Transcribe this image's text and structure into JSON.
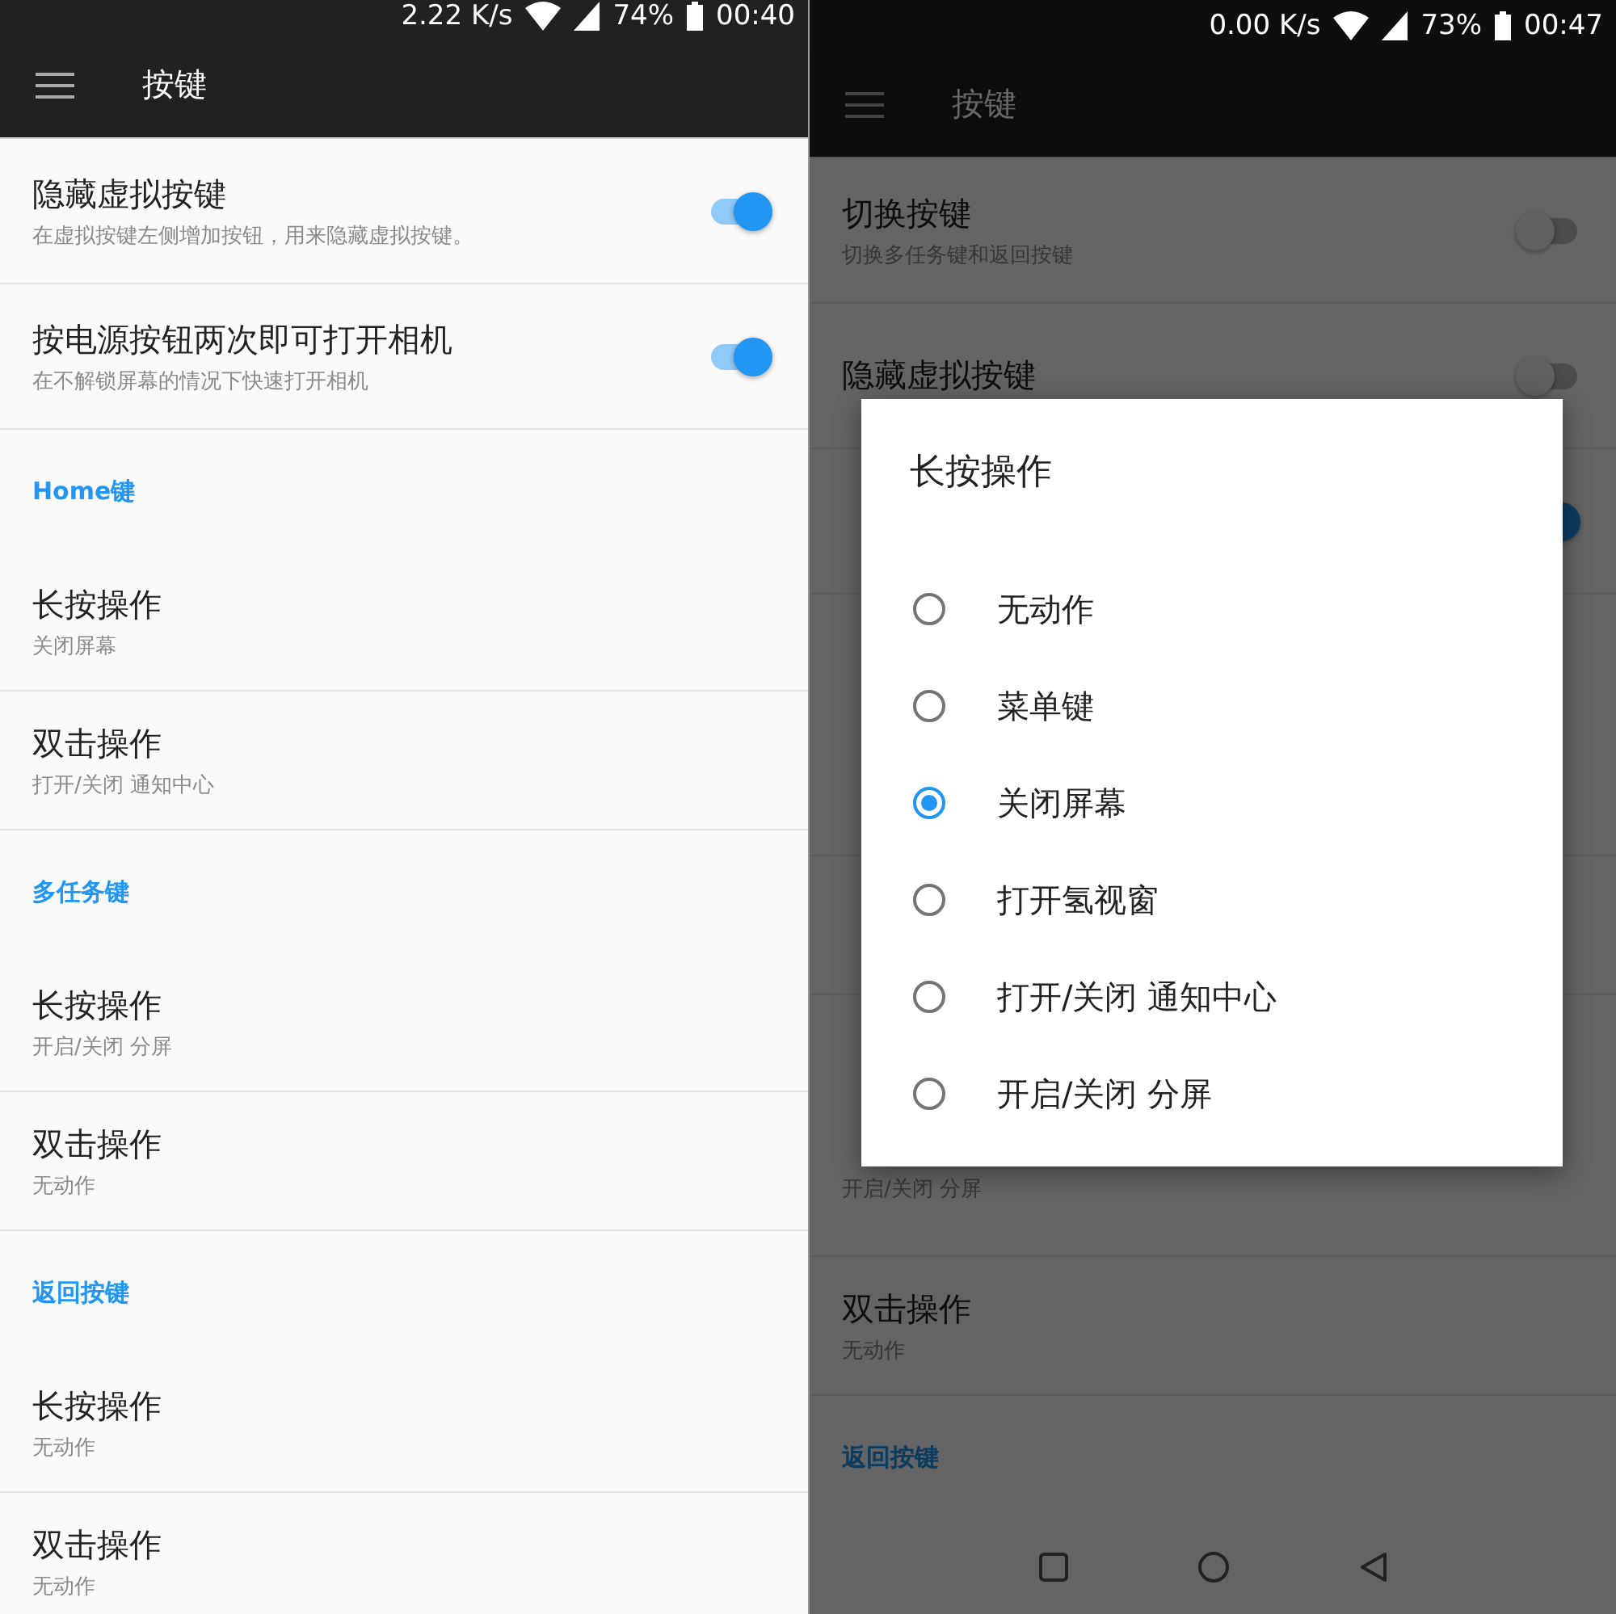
{
  "screens": [
    {
      "status_bar": {
        "speed": "2.22 K/s",
        "battery": "74%",
        "time": "00:40"
      },
      "toolbar": {
        "title": "按键"
      },
      "items": [
        {
          "kind": "toggle",
          "title": "隐藏虚拟按键",
          "subtitle": "在虚拟按键左侧增加按钮，用来隐藏虚拟按键。",
          "on": true
        },
        {
          "kind": "toggle",
          "title": "按电源按钮两次即可打开相机",
          "subtitle": "在不解锁屏幕的情况下快速打开相机",
          "on": true
        },
        {
          "kind": "header",
          "title": "Home键"
        },
        {
          "kind": "option",
          "title": "长按操作",
          "subtitle": "关闭屏幕"
        },
        {
          "kind": "option",
          "title": "双击操作",
          "subtitle": "打开/关闭 通知中心"
        },
        {
          "kind": "header",
          "title": "多任务键"
        },
        {
          "kind": "option",
          "title": "长按操作",
          "subtitle": "开启/关闭 分屏"
        },
        {
          "kind": "option",
          "title": "双击操作",
          "subtitle": "无动作"
        },
        {
          "kind": "header",
          "title": "返回按键"
        },
        {
          "kind": "option",
          "title": "长按操作",
          "subtitle": "无动作"
        },
        {
          "kind": "option",
          "title": "双击操作",
          "subtitle": "无动作"
        }
      ]
    },
    {
      "status_bar": {
        "speed": "0.00 K/s",
        "battery": "73%",
        "time": "00:47"
      },
      "toolbar": {
        "title": "按键"
      },
      "dimmed": true,
      "nav_bar": true,
      "items": [
        {
          "kind": "toggle",
          "title": "切换按键",
          "subtitle": "切换多任务键和返回按键",
          "on": false
        },
        {
          "kind": "toggle",
          "title": "隐藏虚拟按键",
          "on": false
        },
        {
          "kind": "toggle",
          "on": true
        },
        {
          "kind": "header"
        },
        {
          "kind": "option"
        },
        {
          "kind": "option"
        },
        {
          "kind": "header"
        },
        {
          "kind": "option",
          "subtitle": "开启/关闭 分屏"
        },
        {
          "kind": "option",
          "title": "双击操作",
          "subtitle": "无动作"
        },
        {
          "kind": "header",
          "title": "返回按键"
        }
      ],
      "dialog": {
        "title": "长按操作",
        "options": [
          {
            "label": "无动作",
            "selected": false
          },
          {
            "label": "菜单键",
            "selected": false
          },
          {
            "label": "关闭屏幕",
            "selected": true
          },
          {
            "label": "打开氢视窗",
            "selected": false
          },
          {
            "label": "打开/关闭 通知中心",
            "selected": false
          },
          {
            "label": "开启/关闭 分屏",
            "selected": false
          }
        ]
      }
    }
  ]
}
